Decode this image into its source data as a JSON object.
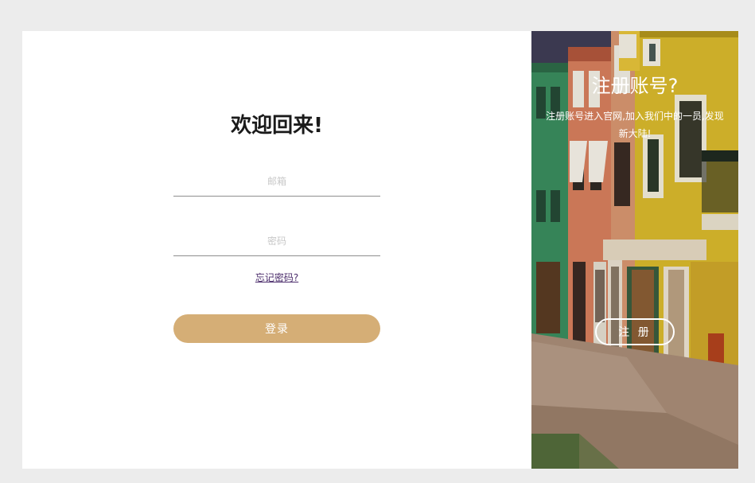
{
  "login": {
    "title": "欢迎回来!",
    "email_placeholder": "邮箱",
    "password_placeholder": "密码",
    "forgot_label": "忘记密码?",
    "submit_label": "登录"
  },
  "register": {
    "title": "注册账号?",
    "description": "注册账号进入官网,加入我们中的一员,发现新大陆!",
    "button_label": "注 册"
  },
  "colors": {
    "page_background": "#ececec",
    "card_background": "#ffffff",
    "accent": "#d5ae76",
    "link": "#4b2c6b"
  },
  "icons": {
    "register_background": "colorful-street-illustration"
  }
}
